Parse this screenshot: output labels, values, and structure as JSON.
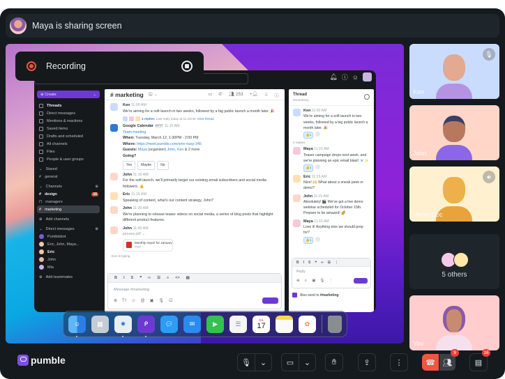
{
  "topbar": {
    "title": "Maya is sharing screen"
  },
  "recording": {
    "label": "Recording"
  },
  "shared_app": {
    "sidebar": {
      "create_label": "Create",
      "nav": [
        "Threads",
        "Direct messages",
        "Mentions & reactions",
        "Saved items",
        "Drafts and scheduled",
        "All channels",
        "Files",
        "People & user groups"
      ],
      "starred_label": "Stared",
      "starred": [
        "general"
      ],
      "channels_label": "Channels",
      "channels": [
        {
          "name": "design",
          "badge": "16"
        },
        {
          "name": "managers"
        },
        {
          "name": "marketing"
        }
      ],
      "add_channels": "Add channels",
      "dm_label": "Direct messages",
      "dms": [
        "Pumblebot",
        "Eric, John, Maya...",
        "Eric",
        "John",
        "Mia"
      ],
      "add_teammates": "Add teammates"
    },
    "channel": {
      "name": "# marketing",
      "member_count": "253",
      "messages": [
        {
          "author": "Ken",
          "time": "11:00 AM",
          "text": "We're aiming for a soft launch in two weeks, followed by a big public launch a month later. 🎉",
          "replies": "4 replies",
          "last_reply": "Last reply today at 11:15AM",
          "view_thread": "View thread"
        },
        {
          "author": "Google Calendar",
          "tag": "APP",
          "time": "11:10 AM",
          "event": "Team meeting",
          "when_label": "When:",
          "when": "Tuesday, March 12, 1:30PM - 2:00 PM",
          "where_label": "Where:",
          "where": "https://meet.pumble.com/smv-easy-345",
          "guests_label": "Guests:",
          "guests_pre": "Maya",
          "guests_mid": " (organizer) ",
          "guests_j": "John",
          "guests_k": "Ken",
          "guests_post": " & 2 more",
          "going": "Going?",
          "buttons": [
            "Yes",
            "Maybe",
            "No"
          ]
        },
        {
          "author": "John",
          "time": "11:10 AM",
          "text": "For the soft launch, we'll primarily target our existing email subscribers and social media followers. 👍"
        },
        {
          "author": "Eric",
          "time": "11:15 AM",
          "text": "Speaking of content, what's our content strategy, John?"
        },
        {
          "author": "John",
          "time": "11:20 AM",
          "text": "We're planning to release teaser videos on social media, a series of blog posts that highlight different product features."
        },
        {
          "author": "John",
          "time": "11:50 AM",
          "attachment_name": "january.pdf",
          "file_title": "Monthly report for January",
          "file_type": "PDF"
        }
      ],
      "typing": "Ken is typing",
      "composer_placeholder": "Message #marketing",
      "toolbar": [
        "B",
        "I",
        "S",
        "❝",
        "∞",
        "☰",
        "≡",
        "<>",
        "▤"
      ]
    },
    "thread": {
      "title": "Thread",
      "channel": "#marketing",
      "root": {
        "author": "Ken",
        "time": "11:00 AM",
        "text": "We're aiming for a soft launch in two weeks, followed by a big public launch a month later. 🎉",
        "reaction": "👍1"
      },
      "reply_count": "4 replies",
      "replies": [
        {
          "author": "Maya",
          "time": "11:10 AM",
          "text": "Teaser campaign drops next week, and we're planning an epic email blast! 📧✨",
          "reaction": "👍1"
        },
        {
          "author": "Eric",
          "time": "11:15 AM",
          "text": "Nice! 🙌 What about a sneak peek or demo?"
        },
        {
          "author": "John",
          "time": "11:15 AM",
          "text": "Absolutely! 🎬 We've got a live demo webinar scheduled for October 15th. Prepare to be amazed! 🌈"
        },
        {
          "author": "Maya",
          "time": "11:15 AM",
          "text": "Love it! Anything else we should prep for?",
          "reaction": "👍1"
        }
      ],
      "reply_placeholder": "Reply",
      "also_send": "Also send to ",
      "also_send_channel": "#marketing"
    },
    "dock": [
      "Finder",
      "Launchpad",
      "Safari",
      "Pumble",
      "Messages",
      "Mail",
      "FaceTime",
      "Reminders",
      "Calendar",
      "Notes",
      "Photos",
      "Trash"
    ],
    "calendar_day": "17",
    "calendar_month": "JUL"
  },
  "participants": [
    {
      "name": "Ken",
      "muted": true,
      "bg": "#c9dcfd",
      "shirt": "#b493e3"
    },
    {
      "name": "John",
      "bg": "#ffd6c8",
      "shirt": "#8c66e8"
    },
    {
      "name": "Meow Doc",
      "speaking": true,
      "bg": "#fff1cf",
      "shirt": "#e8a33a"
    }
  ],
  "others": {
    "label": "5 others"
  },
  "self": {
    "name": "You",
    "bg": "#ffcdcd"
  },
  "bottom": {
    "brand": "pumble",
    "participants_badge": "9",
    "chat_badge": "16"
  },
  "colors": {
    "accent": "#6c3ad1",
    "danger": "#f1543f",
    "badge": "#e8423a"
  }
}
